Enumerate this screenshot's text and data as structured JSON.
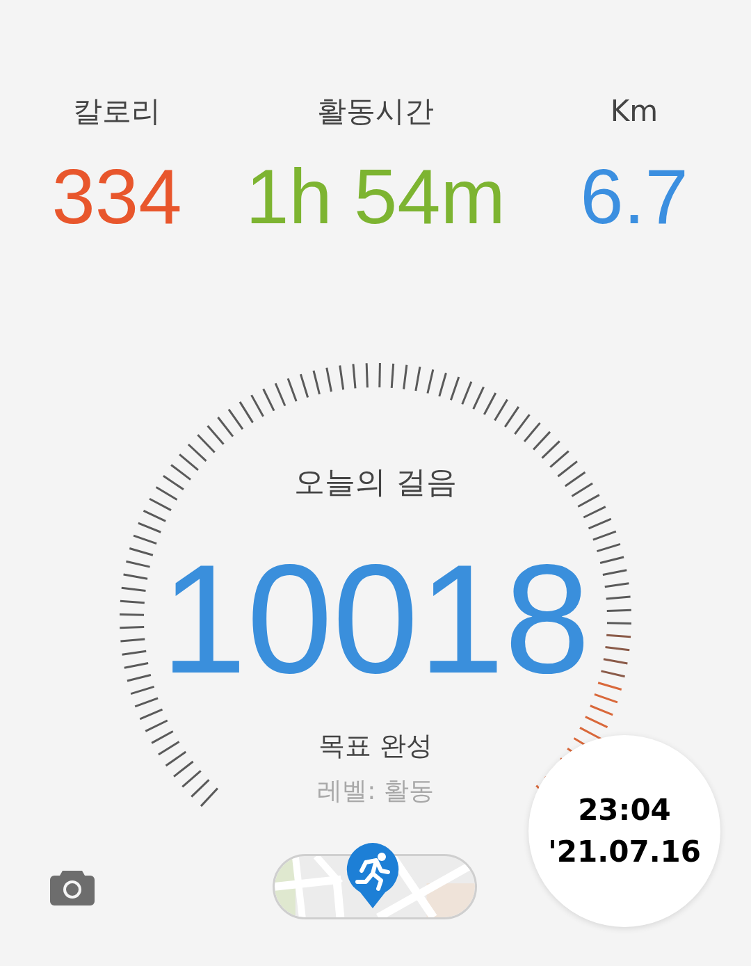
{
  "metrics": [
    {
      "label": "칼로리",
      "value": "334",
      "color": "#e8562c"
    },
    {
      "label": "활동시간",
      "value": "1h 54m",
      "color": "#7db431"
    },
    {
      "label": "Km",
      "value": "6.7",
      "color": "#3b8fe0"
    }
  ],
  "steps": {
    "title": "오늘의 걸음",
    "count": "10018",
    "status": "목표 완성",
    "level_text": "레벨: 활동"
  },
  "timestamp": {
    "time": "23:04",
    "date": "'21.07.16"
  }
}
